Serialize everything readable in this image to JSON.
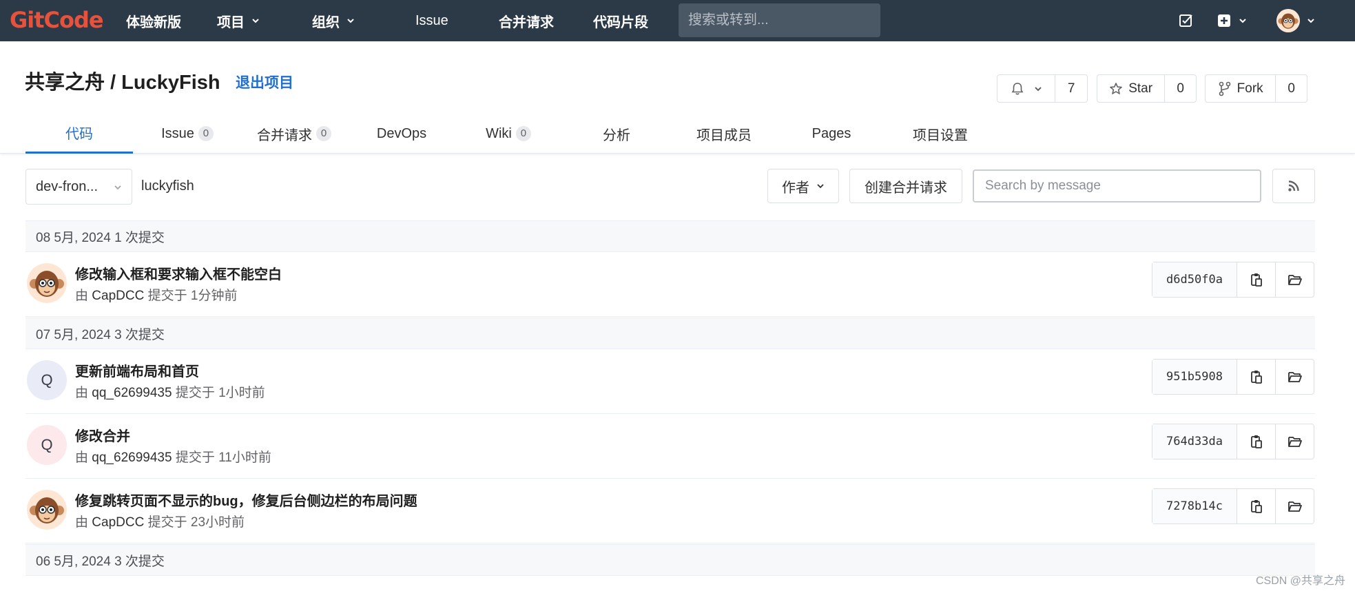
{
  "nav": {
    "logo": "GitCode",
    "items": [
      {
        "label": "体验新版",
        "caret": false
      },
      {
        "label": "项目",
        "caret": true
      },
      {
        "label": "组织",
        "caret": true
      },
      {
        "label": "Issue",
        "caret": false
      },
      {
        "label": "合并请求",
        "caret": false
      },
      {
        "label": "代码片段",
        "caret": false
      }
    ],
    "search_placeholder": "搜索或转到..."
  },
  "project": {
    "title": "共享之舟 / LuckyFish",
    "leave_label": "退出项目",
    "watch_count": "7",
    "star_label": "Star",
    "star_count": "0",
    "fork_label": "Fork",
    "fork_count": "0"
  },
  "tabs": [
    {
      "label": "代码",
      "count": null,
      "active": true
    },
    {
      "label": "Issue",
      "count": "0"
    },
    {
      "label": "合并请求",
      "count": "0"
    },
    {
      "label": "DevOps",
      "count": null
    },
    {
      "label": "Wiki",
      "count": "0"
    },
    {
      "label": "分析",
      "count": null
    },
    {
      "label": "项目成员",
      "count": null
    },
    {
      "label": "Pages",
      "count": null
    },
    {
      "label": "项目设置",
      "count": null
    }
  ],
  "toolbar": {
    "branch": "dev-fron...",
    "path": "luckyfish",
    "author_label": "作者",
    "create_mr_label": "创建合并请求",
    "search_placeholder": "Search by message"
  },
  "groups": [
    {
      "header": "08 5月, 2024 1 次提交",
      "commits": [
        {
          "title": "修改输入框和要求输入框不能空白",
          "by": "由",
          "author": "CapDCC",
          "when": "提交于 1分钟前",
          "sha": "d6d50f0a",
          "avatar": "monkey"
        }
      ]
    },
    {
      "header": "07 5月, 2024 3 次提交",
      "commits": [
        {
          "title": "更新前端布局和首页",
          "by": "由",
          "author": "qq_62699435",
          "when": "提交于 1小时前",
          "sha": "951b5908",
          "avatar": "Q"
        },
        {
          "title": "修改合并",
          "by": "由",
          "author": "qq_62699435",
          "when": "提交于 11小时前",
          "sha": "764d33da",
          "avatar": "Q"
        },
        {
          "title": "修复跳转页面不显示的bug，修复后台侧边栏的布局问题",
          "by": "由",
          "author": "CapDCC",
          "when": "提交于 23小时前",
          "sha": "7278b14c",
          "avatar": "monkey"
        }
      ]
    },
    {
      "header": "06 5月, 2024 3 次提交",
      "commits": []
    }
  ],
  "watermark": "CSDN @共享之舟",
  "colors": {
    "nav_bg": "#2c3a47",
    "accent": "#1f6fd1",
    "logo": "#e8513b"
  }
}
